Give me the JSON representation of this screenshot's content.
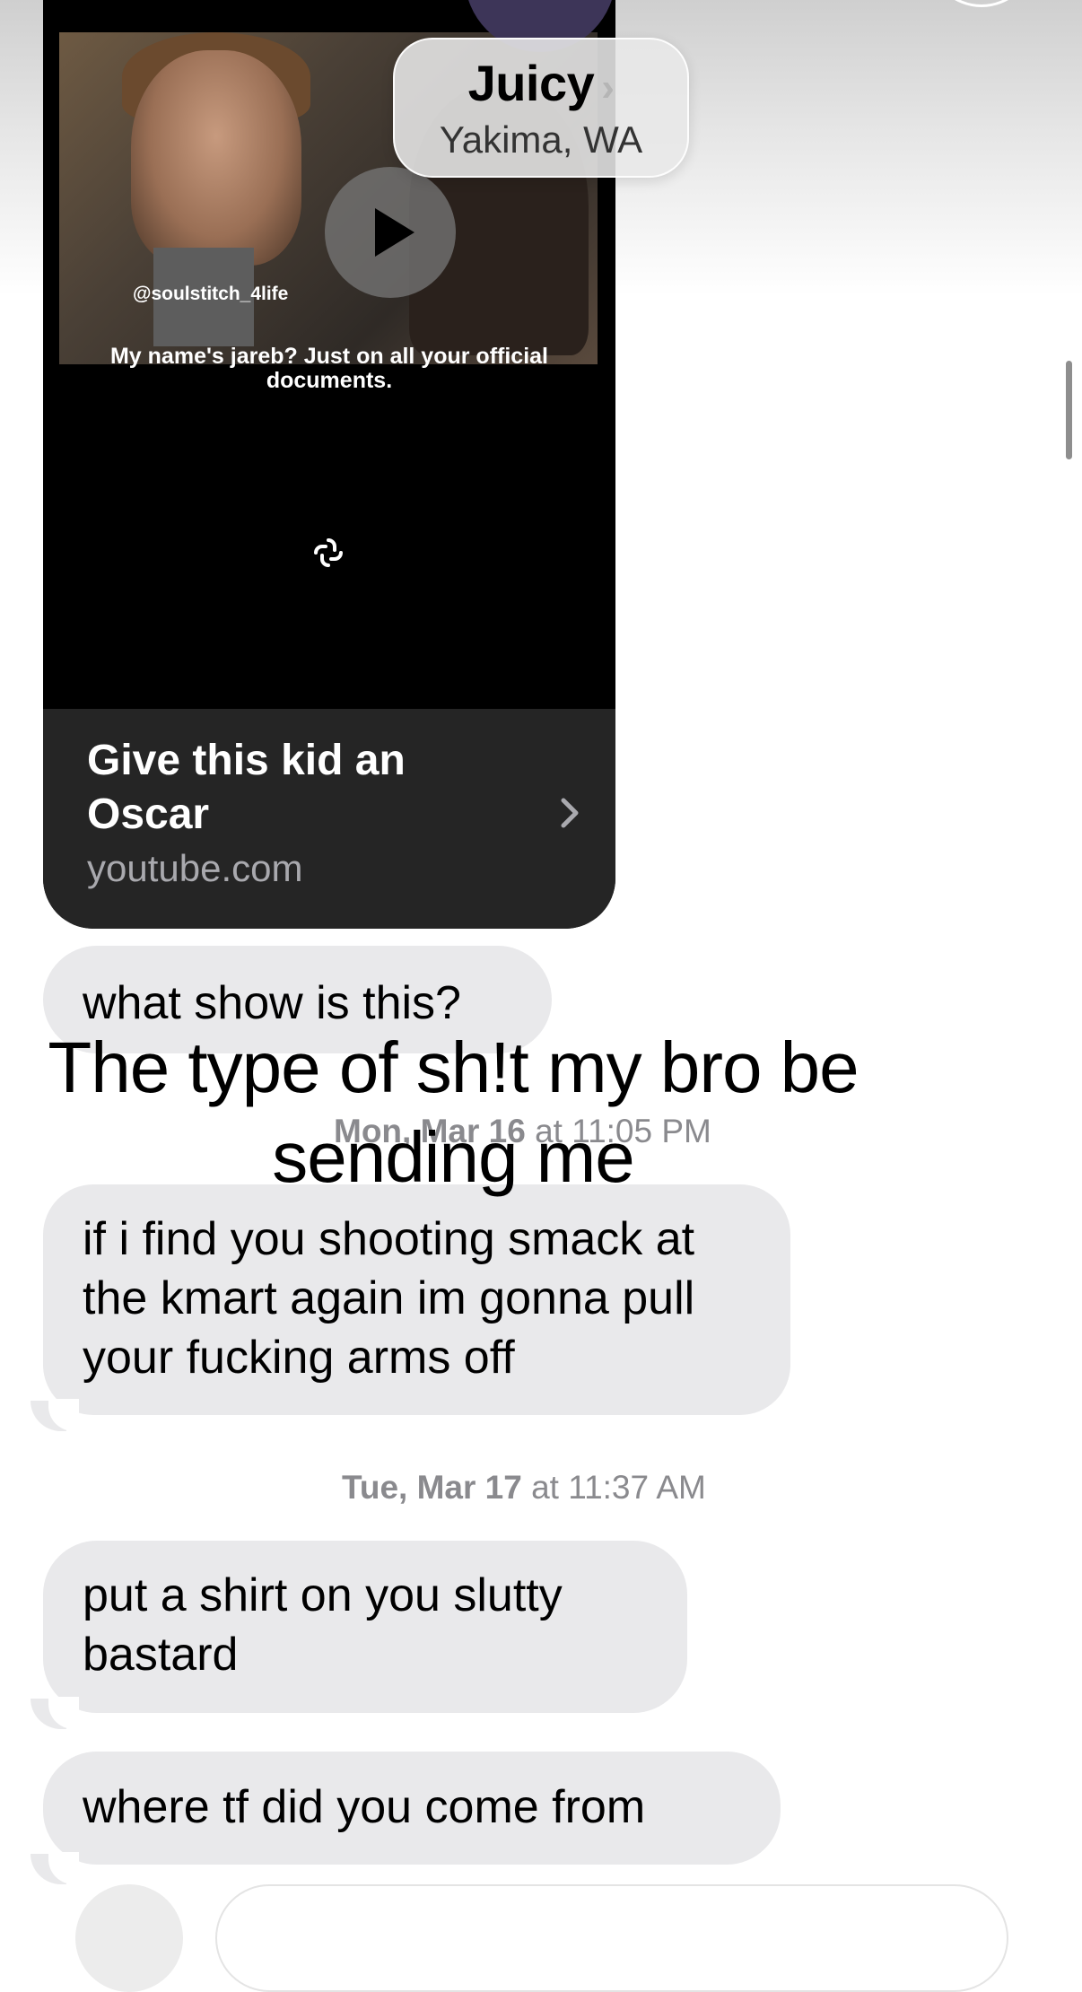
{
  "header": {
    "contact_name": "Juicy",
    "contact_chevron": "›",
    "contact_location": "Yakima, WA",
    "avatar_color": "#3d3558"
  },
  "link_preview": {
    "video_handle": "@soulstitch_4life",
    "video_caption": "My name's jareb? Just on all your official documents.",
    "title": "Give this kid an Oscar",
    "domain": "youtube.com",
    "play_icon": "play-icon",
    "watermark_icon": "swirl-logo-icon"
  },
  "messages": [
    {
      "text": "what show is this?"
    },
    {
      "text": "if i find you shooting smack at the kmart again im gonna pull your fucking arms off"
    },
    {
      "text": "put a shirt on you slutty bastard"
    },
    {
      "text": "where tf did you come from"
    }
  ],
  "timestamps": [
    {
      "day": "Mon, Mar 16",
      "time": "at 11:05 PM"
    },
    {
      "day": "Tue, Mar 17",
      "time": "at 11:37 AM"
    }
  ],
  "overlay_caption": "The type of sh!t my bro be sending me",
  "colors": {
    "received_bubble": "#e9e9eb",
    "timestamp": "#8a8a8e",
    "card_footer": "#252525"
  }
}
